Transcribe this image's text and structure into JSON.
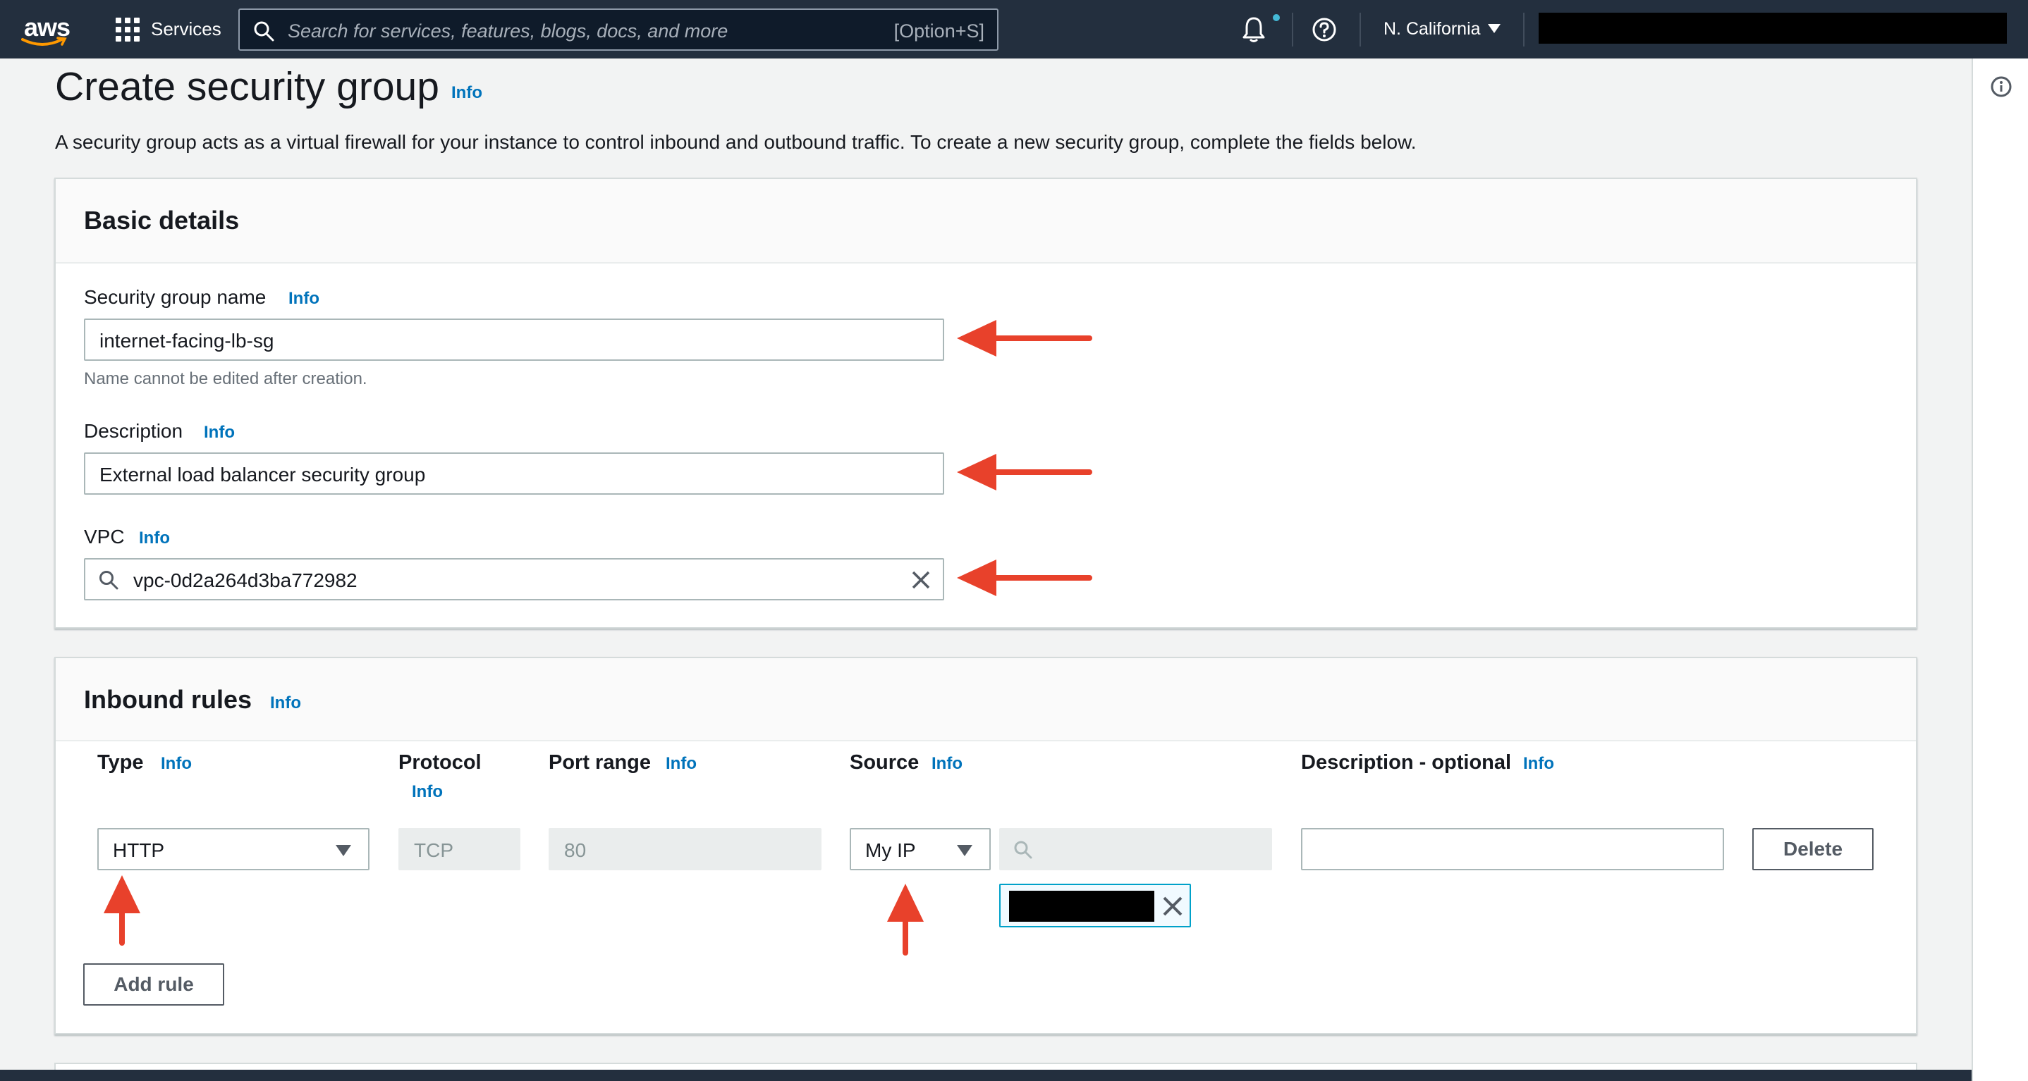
{
  "nav": {
    "logo": "aws",
    "services": "Services",
    "search_placeholder": "Search for services, features, blogs, docs, and more",
    "search_shortcut": "[Option+S]",
    "region": "N. California"
  },
  "header": {
    "title": "Create security group",
    "info": "Info",
    "description": "A security group acts as a virtual firewall for your instance to control inbound and outbound traffic. To create a new security group, complete the fields below."
  },
  "basic_details": {
    "title": "Basic details",
    "name_label": "Security group name",
    "name_info": "Info",
    "name_value": "internet-facing-lb-sg",
    "name_hint": "Name cannot be edited after creation.",
    "desc_label": "Description",
    "desc_info": "Info",
    "desc_value": "External load balancer security group",
    "vpc_label": "VPC",
    "vpc_info": "Info",
    "vpc_value": "vpc-0d2a264d3ba772982"
  },
  "inbound": {
    "title": "Inbound rules",
    "info": "Info",
    "columns": {
      "type": "Type",
      "type_info": "Info",
      "protocol": "Protocol",
      "protocol_info": "Info",
      "port": "Port range",
      "port_info": "Info",
      "source": "Source",
      "source_info": "Info",
      "desc": "Description - optional",
      "desc_info": "Info"
    },
    "rule": {
      "type": "HTTP",
      "protocol": "TCP",
      "port": "80",
      "source": "My IP",
      "description": ""
    },
    "delete_label": "Delete",
    "add_rule_label": "Add rule"
  },
  "colors": {
    "nav_bg": "#232f3e",
    "link": "#0073bb",
    "annotation_arrow": "#e8412b"
  }
}
